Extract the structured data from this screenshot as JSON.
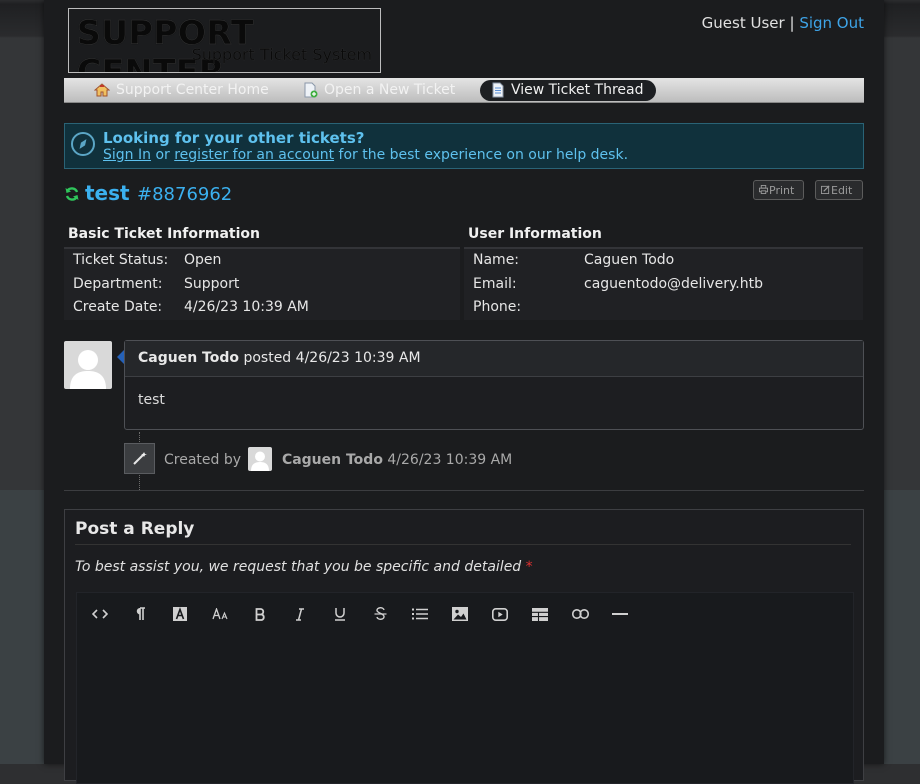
{
  "header": {
    "logo_title": "SUPPORT CENTER",
    "logo_subtitle": "Support Ticket System",
    "user_label": "Guest User",
    "separator": "|",
    "sign_out": "Sign Out"
  },
  "nav": {
    "items": [
      {
        "label": "Support Center Home",
        "icon": "home-icon"
      },
      {
        "label": "Open a New Ticket",
        "icon": "new-ticket-icon"
      },
      {
        "label": "View Ticket Thread",
        "icon": "ticket-thread-icon",
        "active": true
      }
    ]
  },
  "banner": {
    "title": "Looking for your other tickets?",
    "sign_in": "Sign In",
    "or": "or",
    "register": "register for an account",
    "suffix": "for the best experience on our help desk."
  },
  "ticket": {
    "subject": "test",
    "number": "#8876962",
    "print_label": "Print",
    "edit_label": "Edit"
  },
  "basic_info": {
    "heading": "Basic Ticket Information",
    "rows": [
      {
        "label": "Ticket Status:",
        "value": "Open"
      },
      {
        "label": "Department:",
        "value": "Support"
      },
      {
        "label": "Create Date:",
        "value": "4/26/23 10:39 AM"
      }
    ]
  },
  "user_info": {
    "heading": "User Information",
    "rows": [
      {
        "label": "Name:",
        "value": "Caguen Todo"
      },
      {
        "label": "Email:",
        "value": "caguentodo@delivery.htb"
      },
      {
        "label": "Phone:",
        "value": ""
      }
    ]
  },
  "thread": {
    "author": "Caguen Todo",
    "posted": "posted",
    "date": "4/26/23 10:39 AM",
    "body": "test",
    "event_created_by": "Created by",
    "event_author": "Caguen Todo",
    "event_date": "4/26/23 10:39 AM"
  },
  "reply": {
    "title": "Post a Reply",
    "note": "To best assist you, we request that you be specific and detailed",
    "required_mark": "*",
    "toolbar": [
      "code-view-icon",
      "paragraph-icon",
      "font-color-icon",
      "font-size-icon",
      "bold-icon",
      "italic-icon",
      "underline-icon",
      "strikethrough-icon",
      "list-icon",
      "image-icon",
      "video-icon",
      "table-icon",
      "link-icon",
      "horizontal-rule-icon"
    ]
  },
  "colors": {
    "accent": "#3bb0ef",
    "banner_bg": "#10313c",
    "refresh_green": "#2fc55b",
    "required_red": "#e03131"
  }
}
